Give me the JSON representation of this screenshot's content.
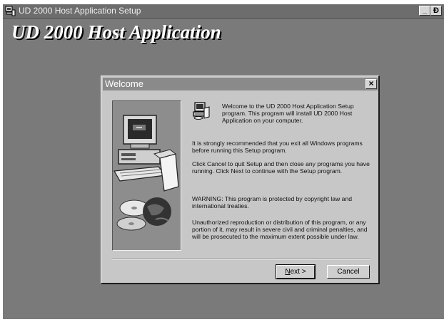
{
  "app": {
    "title": "UD 2000 Host Application Setup",
    "banner": "UD 2000 Host Application",
    "minimize_label": "_",
    "maximize_label": "Ɖ"
  },
  "dialog": {
    "title": "Welcome",
    "close_label": "×",
    "paragraphs": {
      "welcome": "Welcome to the UD 2000 Host Application Setup program.  This program will install UD 2000 Host Application on your computer.",
      "recommend": "It is strongly recommended that you exit all Windows programs before running this Setup program.",
      "cancel_info": "Click Cancel to quit Setup and then close any programs you have running.  Click Next to continue with the Setup program.",
      "warning": "WARNING: This program is protected by copyright law and international treaties.",
      "unauthorized": "Unauthorized reproduction or distribution of this program, or any portion of it, may result in severe civil and criminal penalties, and will be prosecuted to the maximum extent possible under law."
    },
    "buttons": {
      "next_mnemonic": "N",
      "next_rest": "ext >",
      "cancel": "Cancel"
    }
  },
  "icons": {
    "app_icon": "setup-computer-icon",
    "dialog_icon": "setup-computer-icon",
    "artwork": "computer-with-cds-illustration"
  },
  "colors": {
    "desktop": "#7a7a7a",
    "dialog_face": "#c7c7c7",
    "title_bar": "#8a8a8a"
  }
}
